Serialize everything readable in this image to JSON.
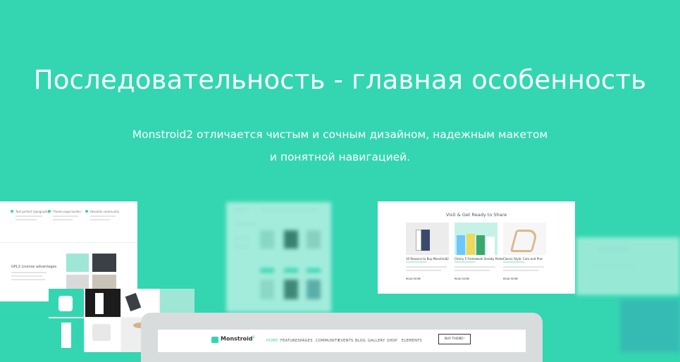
{
  "hero": {
    "title": "Последовательность - главная особенность",
    "subtitle_line1": "Monstroid2 отличается чистым и сочным дизайном, надежным макетом",
    "subtitle_line2": "и понятной навигацией."
  },
  "left_card": {
    "features": [
      "Text perfect typography",
      "Theme page builder",
      "Absolute community"
    ],
    "license": "GPL3 License advantages"
  },
  "share_card": {
    "title": "Visit & Get Ready to Share",
    "posts": [
      {
        "title": "10 Reasons to Buy Monstroid2",
        "more": "READ MORE"
      },
      {
        "title": "Cherry 5 Framework Sneaky Peeks",
        "more": "READ MORE"
      },
      {
        "title": "Classic Style: Cons and Pros",
        "more": "READ MORE"
      }
    ]
  },
  "browser": {
    "logo": "Monstroid",
    "logo_sup": "2",
    "nav": [
      "HOME",
      "FEATURES",
      "PAGES",
      "COMMUNITY",
      "EVENTS",
      "BLOG",
      "GALLERY",
      "SHOP",
      "ELEMENTS"
    ],
    "cta": "BUY THEME!"
  },
  "colors": {
    "accent": "#33d6b1",
    "text": "#ffffff"
  }
}
